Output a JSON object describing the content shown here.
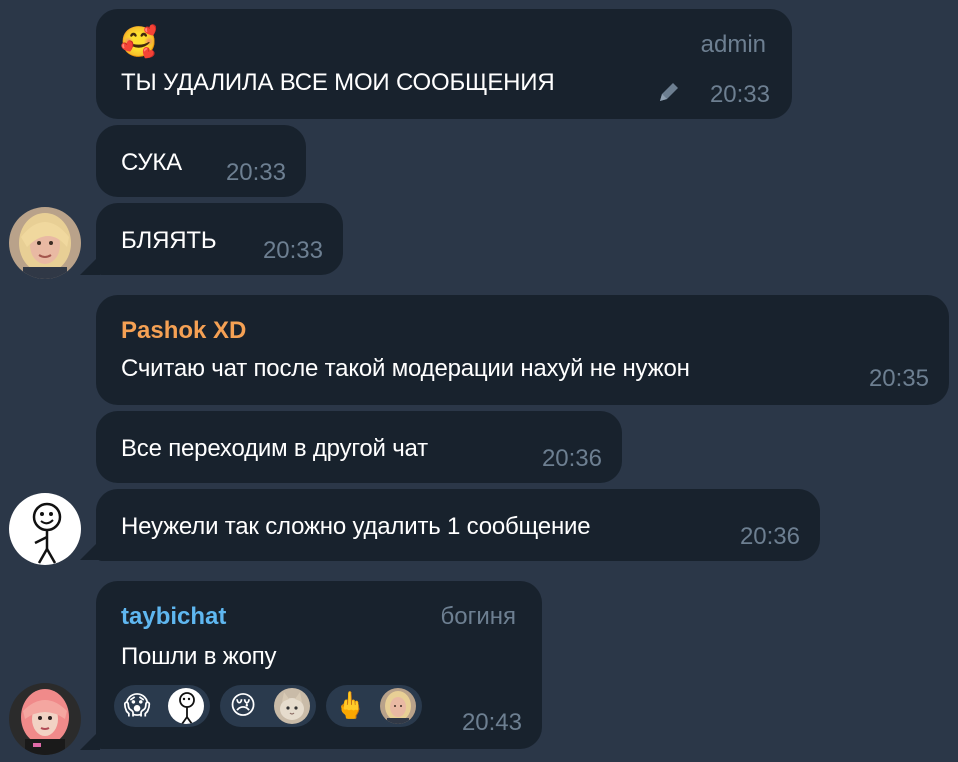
{
  "messages": [
    {
      "emoji": "🥰",
      "role": "admin",
      "text": "ТЫ УДАЛИЛА ВСЕ МОИ СООБЩЕНИЯ",
      "time": "20:33"
    },
    {
      "text": "СУКА",
      "time": "20:33"
    },
    {
      "text": "БЛЯЯТЬ",
      "time": "20:33"
    },
    {
      "sender": "Pashok XD",
      "text": "Считаю чат после такой модерации нахуй не нужон",
      "time": "20:35"
    },
    {
      "text": "Все переходим в другой чат",
      "time": "20:36"
    },
    {
      "text": "Неужели так сложно удалить 1 сообщение",
      "time": "20:36"
    },
    {
      "sender": "taybichat",
      "role": "богиня",
      "text": "Пошли в жопу",
      "time": "20:43"
    }
  ],
  "reactions": [
    {
      "emoji": "😱",
      "icon": "scream-emoji"
    },
    {
      "emoji": "😢",
      "icon": "crying-emoji"
    },
    {
      "emoji": "🖕",
      "icon": "middle-finger-emoji"
    }
  ],
  "colors": {
    "background": "#2b3748",
    "bubble": "#18222d",
    "meta": "#6d7f91",
    "sender_pashok": "#f5a154",
    "sender_taybichat": "#5fb7f0"
  }
}
